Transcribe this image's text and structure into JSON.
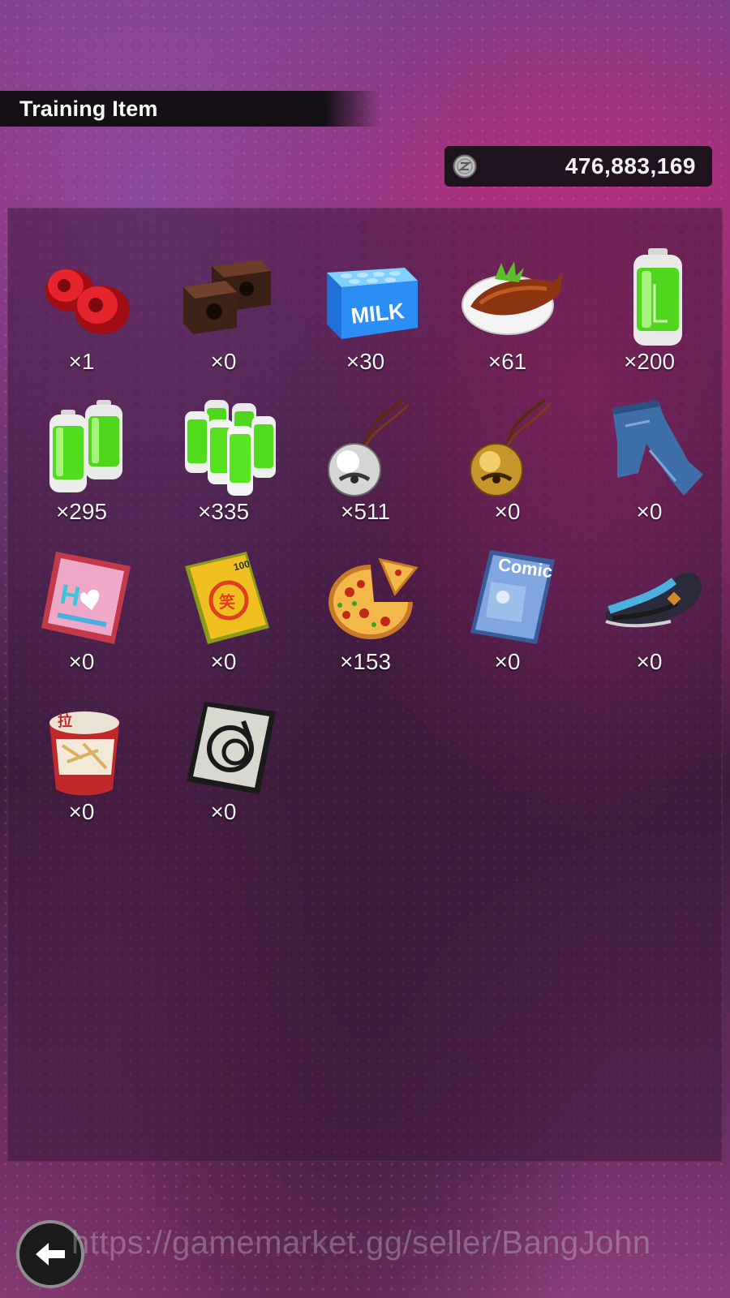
{
  "header": {
    "title": "Training Item"
  },
  "currency": {
    "icon": "zeni-coin-icon",
    "value": "476,883,169"
  },
  "items": [
    {
      "name": "red-weights",
      "count": "×1"
    },
    {
      "name": "brown-weights",
      "count": "×0"
    },
    {
      "name": "milk-crate",
      "count": "×30"
    },
    {
      "name": "grilled-fish",
      "count": "×61"
    },
    {
      "name": "battery-single",
      "count": "×200"
    },
    {
      "name": "battery-double",
      "count": "×295"
    },
    {
      "name": "battery-pack",
      "count": "×335"
    },
    {
      "name": "silver-bell",
      "count": "×511"
    },
    {
      "name": "gold-bell",
      "count": "×0"
    },
    {
      "name": "jeans",
      "count": "×0"
    },
    {
      "name": "romance-book",
      "count": "×0"
    },
    {
      "name": "joke-book",
      "count": "×0"
    },
    {
      "name": "pizza",
      "count": "×153"
    },
    {
      "name": "comic-book",
      "count": "×0"
    },
    {
      "name": "shoe-insole",
      "count": "×0"
    },
    {
      "name": "ramen-cup",
      "count": "×0"
    },
    {
      "name": "capsule-card",
      "count": "×0"
    }
  ],
  "back_button": {
    "icon": "back-arrow-icon"
  },
  "watermark": "https://gamemarket.gg/seller/BangJohn"
}
